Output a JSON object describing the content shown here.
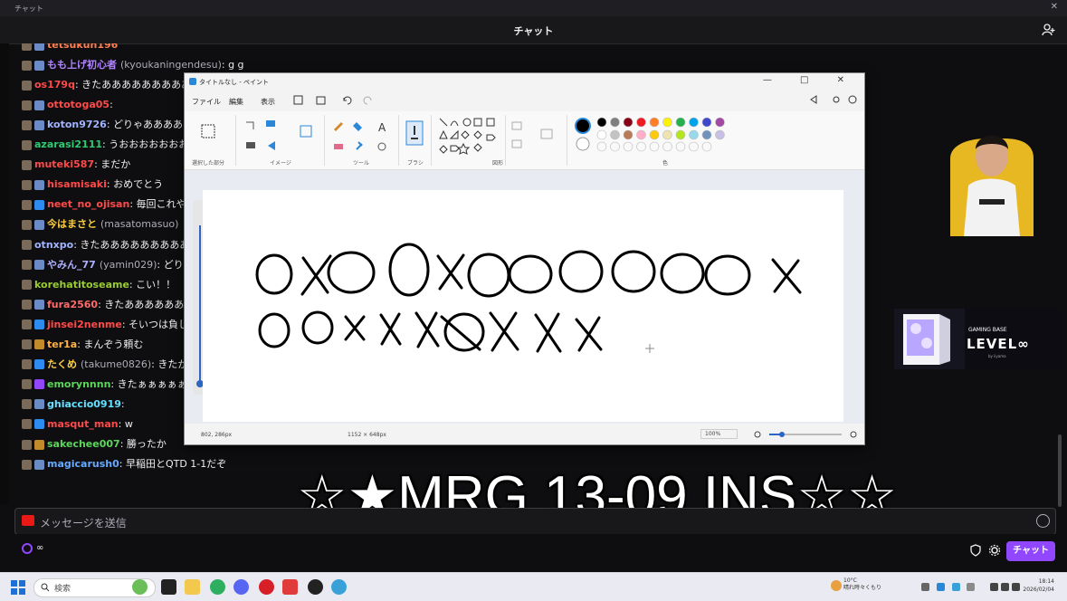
{
  "window": {
    "title": "チャット",
    "close": "✕"
  },
  "chat": {
    "header": "チャット",
    "messages": [
      {
        "user": "tetsukun196",
        "handle": "",
        "text": "",
        "color": "#ff7f50",
        "badge": "a"
      },
      {
        "user": "もも上げ初心者",
        "handle": "(kyoukaningendesu)",
        "text": ": g g",
        "color": "#b084ff",
        "badge": "a"
      },
      {
        "user": "os179q",
        "handle": "",
        "text": ": きたあああああああああああ",
        "color": "#ff4a4a",
        "badge": ""
      },
      {
        "user": "ottotoga05",
        "handle": "",
        "text": ": ",
        "color": "#ff4a4a",
        "badge": "a"
      },
      {
        "user": "koton9726",
        "handle": "",
        "text": ": どりゃあああああああああ",
        "color": "#a0b4ff",
        "badge": "a"
      },
      {
        "user": "azarasi2111",
        "handle": "",
        "text": ": うおおおおおおおお",
        "color": "#2ecc71",
        "badge": ""
      },
      {
        "user": "muteki587",
        "handle": "",
        "text": ": まだか",
        "color": "#ff4a4a",
        "badge": ""
      },
      {
        "user": "hisamisaki",
        "handle": "",
        "text": ": おめでとう",
        "color": "#ff4a4a",
        "badge": "a"
      },
      {
        "user": "neet_no_ojisan",
        "handle": "",
        "text": ": 毎回これやん",
        "color": "#ff4a4a",
        "badge": "b"
      },
      {
        "user": "今はまさと",
        "handle": "(masatomasuo)",
        "text": "",
        "color": "#ffcf40",
        "badge": "a"
      },
      {
        "user": "otnxpo",
        "handle": "",
        "text": ": きたあああああああああああ",
        "color": "#a0b4ff",
        "badge": ""
      },
      {
        "user": "やみん_77",
        "handle": "(yamin029)",
        "text": ": どりゃ",
        "color": "#b0b0ff",
        "badge": "a"
      },
      {
        "user": "korehatitoseame",
        "handle": "",
        "text": ": こい！！",
        "color": "#9acd32",
        "badge": ""
      },
      {
        "user": "fura2560",
        "handle": "",
        "text": ": きたあああああああ",
        "color": "#ff6a6a",
        "badge": "a"
      },
      {
        "user": "jinsei2nenme",
        "handle": "",
        "text": ": そいつは負しの",
        "color": "#ff4a4a",
        "badge": "b"
      },
      {
        "user": "ter1a",
        "handle": "",
        "text": ": まんぞう頼む",
        "color": "#ffb347",
        "badge": "c"
      },
      {
        "user": "たくめ",
        "handle": "(takume0826)",
        "text": ": きたか",
        "color": "#ffcf40",
        "badge": "b"
      },
      {
        "user": "emorynnnn",
        "handle": "",
        "text": ": きたぁぁぁぁぁ",
        "color": "#5cd65c",
        "badge": "d"
      },
      {
        "user": "ghiaccio0919",
        "handle": "",
        "text": ": ",
        "color": "#66e0ff",
        "badge": "a"
      },
      {
        "user": "masqut_man",
        "handle": "",
        "text": ": w",
        "color": "#ff4a4a",
        "badge": "b"
      },
      {
        "user": "sakechee007",
        "handle": "",
        "text": ": 勝ったか",
        "color": "#5cd65c",
        "badge": "c"
      },
      {
        "user": "magicarush0",
        "handle": "",
        "text": ": 早稲田とQTD 1-1だぞ",
        "color": "#66aaff",
        "badge": "a"
      }
    ],
    "input_placeholder": "メッセージを送信",
    "points": "∞",
    "chat_button": "チャット"
  },
  "paint": {
    "title": "タイトルなし - ペイント",
    "window_controls": "—  □  ✕",
    "menu": [
      "ファイル",
      "編集",
      "表示"
    ],
    "groups": {
      "select": "選択した部分",
      "image": "イメージ",
      "tools": "ツール",
      "brush": "ブラシ",
      "shapes": "図形",
      "colors": "色"
    },
    "status": {
      "cursor": "802, 286px",
      "size": "1152 × 648px",
      "zoom": "100%"
    },
    "palette_top": [
      "#000000",
      "#7f7f7f",
      "#880015",
      "#ed1c24",
      "#ff7f27",
      "#fff200",
      "#22b14c",
      "#00a2e8",
      "#3f48cc",
      "#a349a4"
    ],
    "palette_bottom": [
      "#ffffff",
      "#c3c3c3",
      "#b97a57",
      "#ffaec9",
      "#ffc90e",
      "#efe4b0",
      "#b5e61d",
      "#99d9ea",
      "#7092be",
      "#c8bfe7"
    ]
  },
  "overlay": {
    "score": "☆★MRG 13-09 INS☆☆"
  },
  "ad": {
    "line1": "GAMING BASE",
    "logo": "LEVEL∞",
    "sub": "by iiyama"
  },
  "taskbar": {
    "search": "検索",
    "weather_temp": "10°C",
    "weather_text": "晴れ時々くもり",
    "time": "18:14",
    "date": "2026/02/04"
  }
}
